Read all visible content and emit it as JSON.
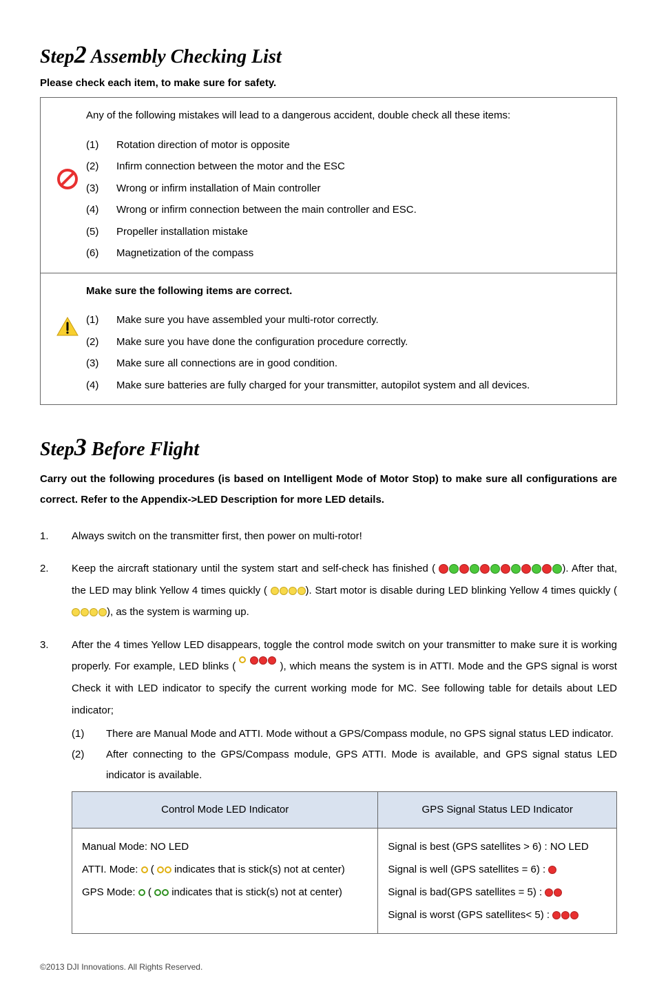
{
  "step2": {
    "title_prefix": "Step",
    "title_num": "2",
    "title_rest": " Assembly Checking List",
    "subtitle": "Please check each item, to make sure for safety.",
    "danger_intro": "Any of the following mistakes will lead to a dangerous accident, double check all these items:",
    "danger_items": [
      {
        "n": "(1)",
        "t": "Rotation direction of motor is opposite"
      },
      {
        "n": "(2)",
        "t": "Infirm connection between the motor and the ESC"
      },
      {
        "n": "(3)",
        "t": "Wrong or infirm installation of Main controller"
      },
      {
        "n": "(4)",
        "t": "Wrong or infirm connection between the main controller and ESC."
      },
      {
        "n": "(5)",
        "t": "Propeller installation mistake"
      },
      {
        "n": "(6)",
        "t": "Magnetization of the compass"
      }
    ],
    "correct_intro": "Make sure the following items are correct.",
    "correct_items": [
      {
        "n": "(1)",
        "t": "Make sure you have assembled your multi-rotor correctly."
      },
      {
        "n": "(2)",
        "t": "Make sure you have done the configuration procedure correctly."
      },
      {
        "n": "(3)",
        "t": "Make sure all connections are in good condition."
      },
      {
        "n": "(4)",
        "t": "Make sure batteries are fully charged for your transmitter, autopilot system and all devices."
      }
    ]
  },
  "step3": {
    "title_prefix": "Step",
    "title_num": "3",
    "title_rest": " Before Flight",
    "intro": "Carry out the following procedures (is based on Intelligent Mode of Motor Stop) to make sure all configurations are correct. Refer to the Appendix->LED Description for more LED details.",
    "items": {
      "i1": {
        "n": "1.",
        "t": "Always switch on the transmitter first, then power on multi-rotor!"
      },
      "i2": {
        "n": "2.",
        "p1": "Keep the aircraft stationary until the system start and self-check has finished (",
        "p2": "). After that, the LED may blink Yellow 4 times quickly (",
        "p3": "). Start motor is disable during LED blinking Yellow 4 times quickly (",
        "p4": "), as the system is warming up."
      },
      "i3": {
        "n": "3.",
        "p1": "After the 4 times Yellow LED disappears, toggle the control mode switch on your transmitter to make sure it is working properly. For example, LED blinks (",
        "p2": "), which means the system is in ATTI. Mode and the GPS signal is worst Check it with LED indicator to specify the current working mode for MC. See following table for details about LED indicator;",
        "sub": [
          {
            "n": "(1)",
            "t": "There are Manual Mode and ATTI. Mode without a GPS/Compass module, no GPS signal status LED indicator."
          },
          {
            "n": "(2)",
            "t": "After connecting to the GPS/Compass module, GPS ATTI. Mode is available, and GPS signal status LED indicator is available."
          }
        ]
      }
    },
    "table": {
      "h1": "Control  Mode  LED  Indicator",
      "h2": "GPS Signal Status LED Indicator",
      "left": {
        "l1": "Manual Mode: NO LED",
        "l2a": "ATTI. Mode:  ",
        "l2b": " ( ",
        "l2c": " indicates that is stick(s) not at center)",
        "l3a": "GPS  Mode:  ",
        "l3b": " ( ",
        "l3c": " indicates  that  is  stick(s)  not  at  center)"
      },
      "right": {
        "l1": "Signal is best (GPS satellites > 6) : NO LED",
        "l2": "Signal is well (GPS satellites = 6) :",
        "l3": "Signal is bad(GPS satellites = 5) :  ",
        "l4": "Signal is worst (GPS satellites< 5) :"
      }
    }
  },
  "footer": "©2013 DJI Innovations. All Rights Reserved."
}
